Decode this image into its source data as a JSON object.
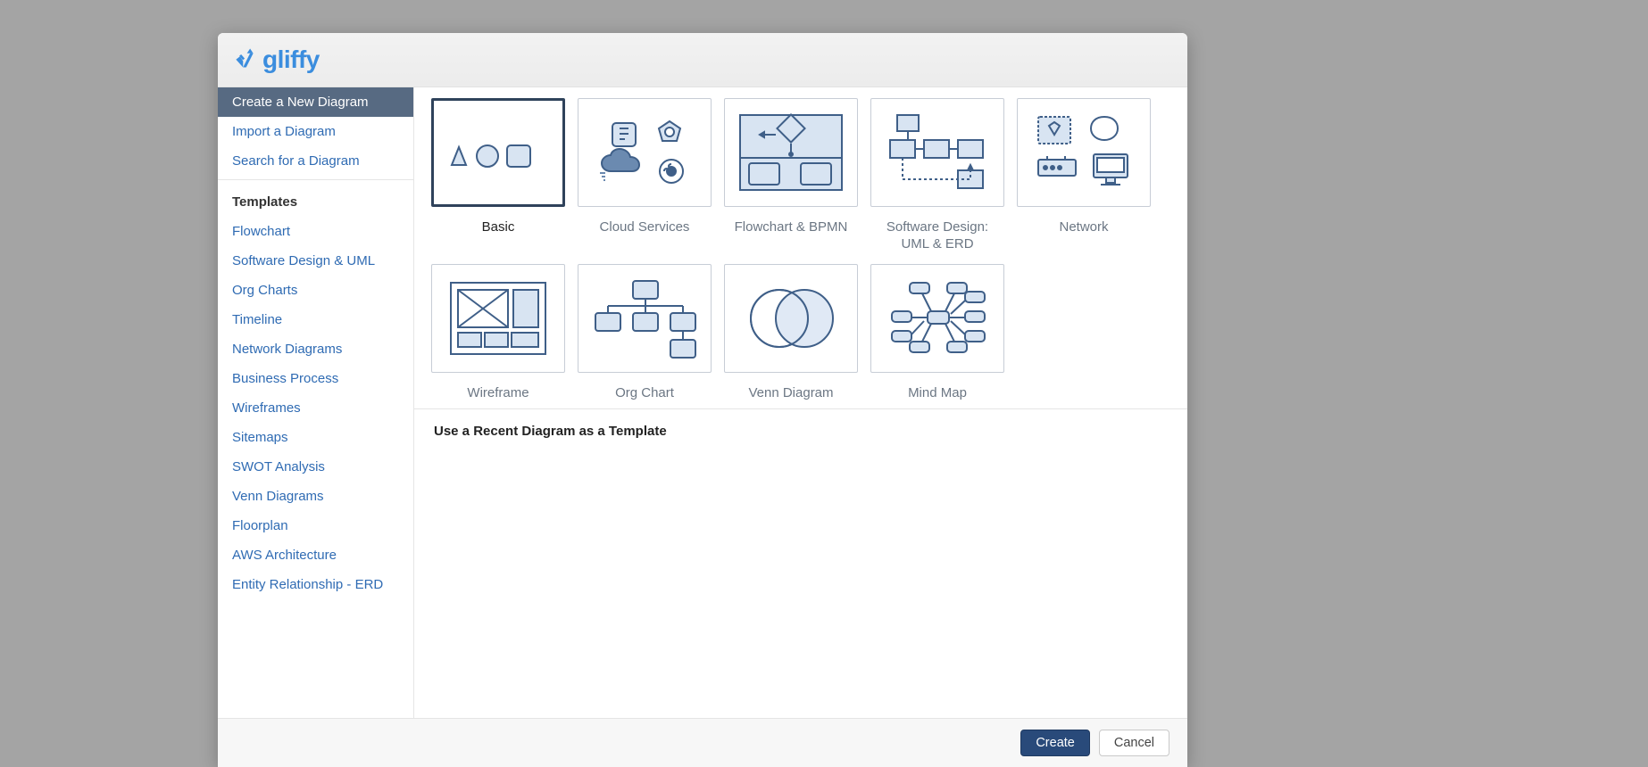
{
  "brand": {
    "name": "gliffy"
  },
  "sidebar": {
    "primary": [
      {
        "label": "Create a New Diagram",
        "active": true
      },
      {
        "label": "Import a Diagram",
        "active": false
      },
      {
        "label": "Search for a Diagram",
        "active": false
      }
    ],
    "templates_title": "Templates",
    "templates": [
      {
        "label": "Flowchart"
      },
      {
        "label": "Software Design & UML"
      },
      {
        "label": "Org Charts"
      },
      {
        "label": "Timeline"
      },
      {
        "label": "Network Diagrams"
      },
      {
        "label": "Business Process"
      },
      {
        "label": "Wireframes"
      },
      {
        "label": "Sitemaps"
      },
      {
        "label": "SWOT Analysis"
      },
      {
        "label": "Venn Diagrams"
      },
      {
        "label": "Floorplan"
      },
      {
        "label": "AWS Architecture"
      },
      {
        "label": "Entity Relationship - ERD"
      }
    ]
  },
  "templates_grid": [
    {
      "label": "Basic",
      "selected": true,
      "icon": "basic"
    },
    {
      "label": "Cloud Services",
      "selected": false,
      "icon": "cloud"
    },
    {
      "label": "Flowchart & BPMN",
      "selected": false,
      "icon": "flowchart"
    },
    {
      "label": "Software Design: UML & ERD",
      "selected": false,
      "icon": "uml"
    },
    {
      "label": "Network",
      "selected": false,
      "icon": "network"
    },
    {
      "label": "Wireframe",
      "selected": false,
      "icon": "wireframe"
    },
    {
      "label": "Org Chart",
      "selected": false,
      "icon": "orgchart"
    },
    {
      "label": "Venn Diagram",
      "selected": false,
      "icon": "venn"
    },
    {
      "label": "Mind Map",
      "selected": false,
      "icon": "mindmap"
    }
  ],
  "recent_title": "Use a Recent Diagram as a Template",
  "footer": {
    "create": "Create",
    "cancel": "Cancel"
  }
}
